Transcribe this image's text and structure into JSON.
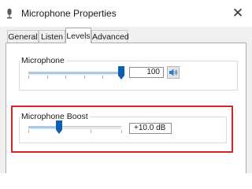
{
  "window": {
    "title": "Microphone Properties",
    "close_symbol": "✕"
  },
  "tabs": [
    {
      "label": "General",
      "active": false
    },
    {
      "label": "Listen",
      "active": false
    },
    {
      "label": "Levels",
      "active": true
    },
    {
      "label": "Advanced",
      "active": false
    }
  ],
  "microphone": {
    "label": "Microphone",
    "value": "100",
    "level_fraction": 1.0,
    "mute_icon": "speaker-icon"
  },
  "boost": {
    "label": "Microphone Boost",
    "value": "+10.0 dB",
    "level_fraction": 0.33
  },
  "colors": {
    "thumb": "#0a5fb0",
    "highlight": "#d6232a",
    "speaker": "#2a78c8"
  }
}
